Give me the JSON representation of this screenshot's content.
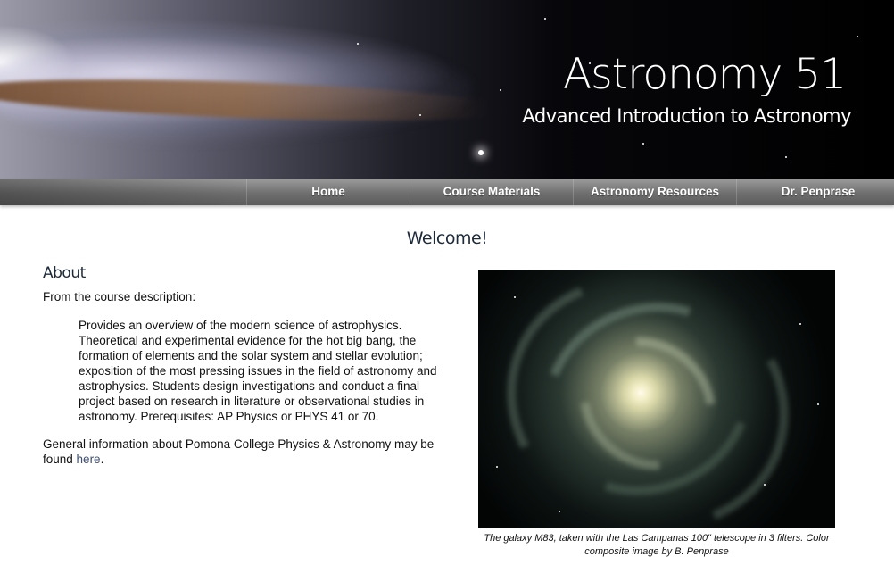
{
  "header": {
    "title": "Astronomy 51",
    "subtitle": "Advanced Introduction to Astronomy"
  },
  "nav": {
    "items": [
      {
        "label": "Home"
      },
      {
        "label": "Course Materials"
      },
      {
        "label": "Astronomy Resources"
      },
      {
        "label": "Dr. Penprase"
      }
    ]
  },
  "main": {
    "welcome": "Welcome!",
    "about_heading": "About",
    "intro": "From the course description:",
    "description": "Provides an overview of the modern science of astrophysics. Theoretical and experimental evidence for the hot big bang, the formation of elements and the solar system and stellar evolution; exposition of the most pressing issues in the field of astronomy and astrophysics. Students design investigations and conduct a final project based on research in literature or observational studies in astronomy. Prerequisites: AP Physics or PHYS 41 or 70.",
    "general_prefix": "General information about Pomona College Physics & Astronomy may be found ",
    "general_link": "here",
    "general_suffix": "."
  },
  "figure": {
    "caption": "The galaxy M83, taken with the Las Campanas 100\" telescope in 3 filters. Color composite image by B. Penprase"
  },
  "colors": {
    "nav_bar": "#6f6f6f",
    "heading_text": "#1d2a3a",
    "link": "#3e4f6f"
  }
}
